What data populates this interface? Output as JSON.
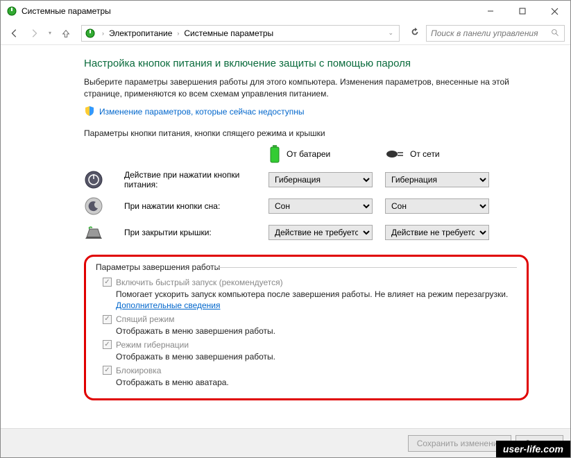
{
  "window": {
    "title": "Системные параметры"
  },
  "nav": {
    "crumb1": "Электропитание",
    "crumb2": "Системные параметры"
  },
  "search": {
    "placeholder": "Поиск в панели управления"
  },
  "page": {
    "heading": "Настройка кнопок питания и включение защиты с помощью пароля",
    "desc": "Выберите параметры завершения работы для этого компьютера. Изменения параметров, внесенные на этой странице, применяются ко всем схемам управления питанием.",
    "shield_link": "Изменение параметров, которые сейчас недоступны",
    "section1": "Параметры кнопки питания, кнопки спящего режима и крышки"
  },
  "columns": {
    "battery": "От батареи",
    "ac": "От сети"
  },
  "rows": {
    "power_btn": "Действие при нажатии кнопки питания:",
    "sleep_btn": "При нажатии кнопки сна:",
    "lid": "При закрытии крышки:"
  },
  "selects": {
    "power_battery": "Гибернация",
    "power_ac": "Гибернация",
    "sleep_battery": "Сон",
    "sleep_ac": "Сон",
    "lid_battery": "Действие не требуется",
    "lid_ac": "Действие не требуется"
  },
  "shutdown": {
    "legend": "Параметры завершения работы",
    "fast_label": "Включить быстрый запуск (рекомендуется)",
    "fast_desc": "Помогает ускорить запуск компьютера после завершения работы. Не влияет на режим перезагрузки. ",
    "fast_link": "Дополнительные сведения",
    "sleep_label": "Спящий режим",
    "sleep_desc": "Отображать в меню завершения работы.",
    "hib_label": "Режим гибернации",
    "hib_desc": "Отображать в меню завершения работы.",
    "lock_label": "Блокировка",
    "lock_desc": "Отображать в меню аватара."
  },
  "footer": {
    "save": "Сохранить изменения",
    "cancel": "Отмена"
  },
  "watermark": "user-life.com"
}
